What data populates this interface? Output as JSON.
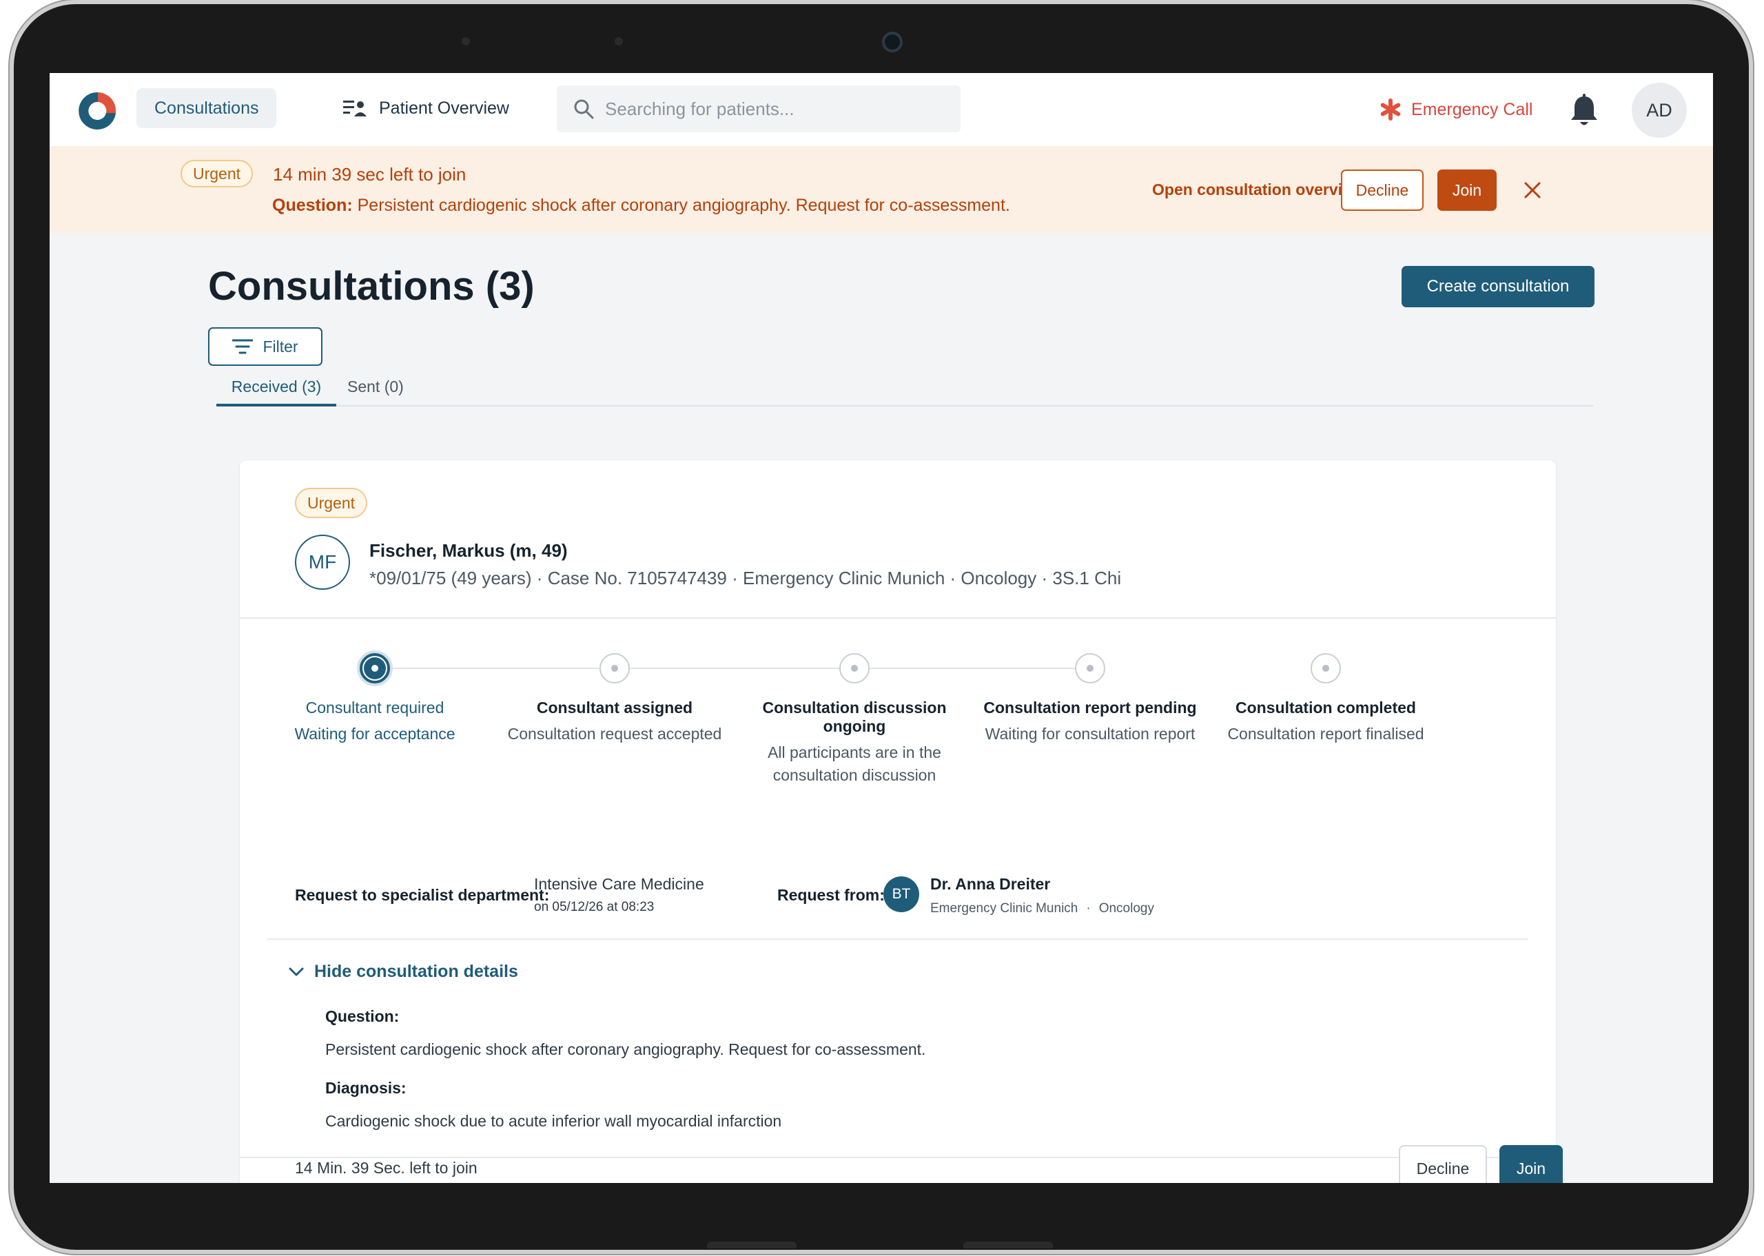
{
  "nav": {
    "consultations_label": "Consultations",
    "patient_overview_label": "Patient Overview",
    "search_placeholder": "Searching for patients...",
    "emergency_label": "Emergency Call",
    "avatar_initials": "AD"
  },
  "banner": {
    "badge": "Urgent",
    "time_left": "14 min 39 sec left to join",
    "question_label": "Question:",
    "question_text": "Persistent cardiogenic shock after coronary angiography. Request for co-assessment.",
    "overview_link": "Open consultation overview",
    "decline_label": "Decline",
    "join_label": "Join"
  },
  "page": {
    "title": "Consultations (3)",
    "create_label": "Create consultation",
    "filter_label": "Filter",
    "tabs": [
      {
        "label": "Received (3)",
        "active": true
      },
      {
        "label": "Sent (0)",
        "active": false
      }
    ]
  },
  "card": {
    "badge": "Urgent",
    "patient_initials": "MF",
    "patient_name": "Fischer, Markus (m, 49)",
    "patient_meta": "*09/01/75 (49 years) · Case No. 7105747439 · Emergency Clinic Munich · Oncology · 3S.1 Chi",
    "steps": [
      {
        "title": "Consultant required",
        "sub": "Waiting for acceptance",
        "state": "current"
      },
      {
        "title": "Consultant assigned",
        "sub": "Consultation request accepted",
        "state": "pending"
      },
      {
        "title": "Consultation discussion ongoing",
        "sub": "All participants are in the consultation discussion",
        "state": "pending"
      },
      {
        "title": "Consultation report pending",
        "sub": "Waiting for consultation report",
        "state": "pending"
      },
      {
        "title": "Consultation completed",
        "sub": "Consultation report finalised",
        "state": "pending"
      }
    ],
    "request_dept_label": "Request to specialist department:",
    "request_dept_value": "Intensive Care Medicine",
    "request_dept_date": "on 05/12/26 at 08:23",
    "request_from_label": "Request from:",
    "requester_initials": "BT",
    "requester_name": "Dr. Anna Dreiter",
    "requester_clinic": "Emergency Clinic Munich",
    "requester_separator": "·",
    "requester_dept": "Oncology",
    "details_toggle": "Hide consultation details",
    "question_label": "Question:",
    "question_text": "Persistent cardiogenic shock after coronary angiography. Request for co-assessment.",
    "diagnosis_label": "Diagnosis:",
    "diagnosis_text": "Cardiogenic shock due to acute inferior wall myocardial infarction",
    "footer_time": "14 Min. 39 Sec. left to join",
    "decline_label": "Decline",
    "join_label": "Join"
  },
  "colors": {
    "primary": "#1f5c7a",
    "urgent_text": "#b5410a",
    "urgent_bg": "#fcefe4",
    "emergency": "#d9453d"
  }
}
